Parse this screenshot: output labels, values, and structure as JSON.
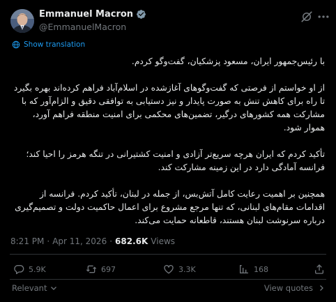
{
  "author": {
    "display_name": "Emmanuel Macron",
    "handle": "@EmmanuelMacron"
  },
  "translate_link": "Show translation",
  "body_paragraphs": [
    "با رئیس‌جمهور ایران، مسعود پزشکیان، گفت‌وگو کردم.",
    "از او خواستم از فرصتی که گفت‌وگوهای آغازشده در اسلام‌آباد فراهم کرده‌اند بهره بگیرد تا راه برای کاهش تنش به صورت پایدار و نیز دستیابی به توافقی دقیق و الزام‌آور که با مشارکت همه کشورهای درگیر، تضمین‌های محکمی برای امنیت منطقه فراهم آورد، هموار شود.",
    "تأکید کردم که ایران هرچه سریع‌تر آزادی و امنیت کشتیرانی در تنگه هرمز را احیا کند؛ فرانسه آمادگی دارد در این زمینه مشارکت کند.",
    "همچنین بر اهمیت رعایت کامل آتش‌بس، از جمله در لبنان، تأکید کردم. فرانسه از اقدامات مقام‌های لبنانی، که تنها مرجع مشروع برای اعمال حاکمیت دولت و تصمیم‌گیری درباره سرنوشت لبنان هستند، قاطعانه حمایت می‌کند."
  ],
  "meta": {
    "time": "8:21 PM",
    "separator": "·",
    "date": "Apr 11, 2026",
    "views_count": "682.6K",
    "views_label": "Views"
  },
  "actions": {
    "replies": "5.9K",
    "reposts": "697",
    "likes": "3.3K",
    "bookmarks": "168"
  },
  "footer": {
    "relevant_label": "Relevant",
    "view_quotes_label": "View quotes"
  },
  "colors": {
    "background": "#000000",
    "text": "#e7e9ea",
    "muted": "#71767b",
    "accent": "#1d9bf0",
    "divider": "#2f3336"
  },
  "icons": [
    "verified-icon",
    "grok-icon",
    "more-icon",
    "translate-icon",
    "reply-icon",
    "repost-icon",
    "like-icon",
    "bookmark-icon",
    "share-icon",
    "chevron-down-icon",
    "chevron-right-icon"
  ]
}
